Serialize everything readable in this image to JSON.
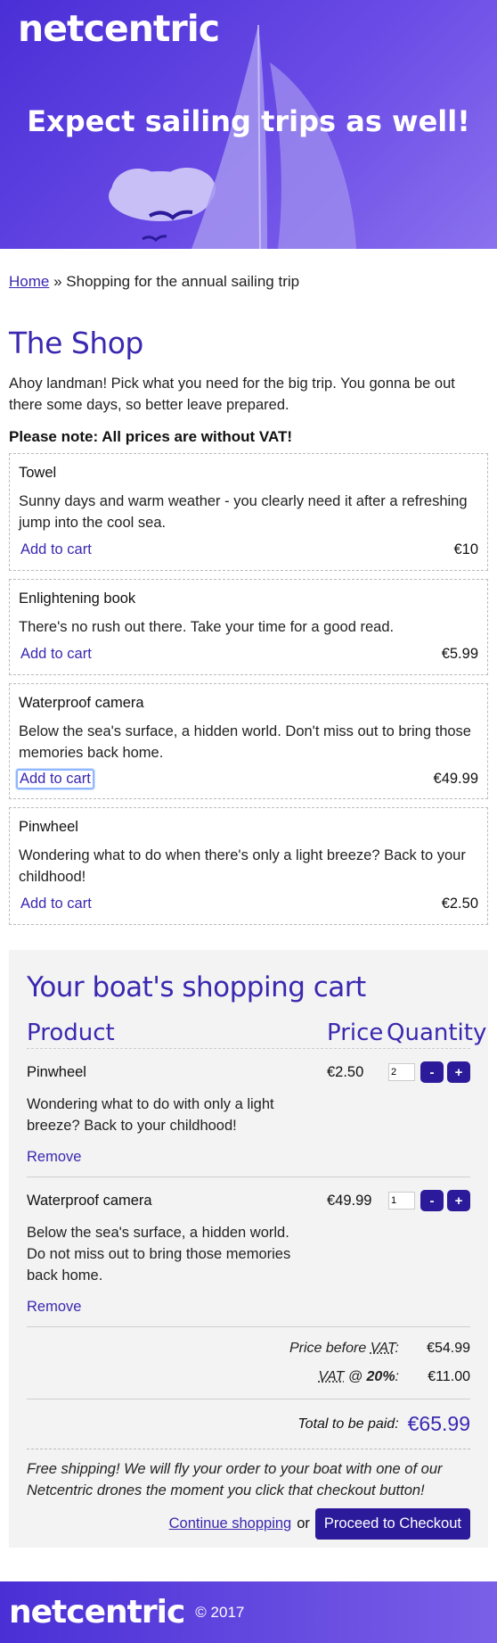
{
  "hero": {
    "logo": "netcentric",
    "headline": "Expect sailing trips as well!"
  },
  "breadcrumb": {
    "home": "Home",
    "separator": "»",
    "current": "Shopping for the annual sailing trip"
  },
  "shop": {
    "title": "The Shop",
    "intro": "Ahoy landman! Pick what you need for the big trip. You gonna be out there some days, so better leave prepared.",
    "note": "Please note: All prices are without VAT!",
    "products": [
      {
        "name": "Towel",
        "desc": "Sunny days and warm weather - you clearly need it after a refreshing jump into the cool sea.",
        "add": "Add to cart",
        "price": "€10"
      },
      {
        "name": "Enlightening book",
        "desc": "There's no rush out there. Take your time for a good read.",
        "add": "Add to cart",
        "price": "€5.99"
      },
      {
        "name": "Waterproof camera",
        "desc": "Below the sea's surface, a hidden world. Don't miss out to bring those memories back home.",
        "add": "Add to cart",
        "price": "€49.99"
      },
      {
        "name": "Pinwheel",
        "desc": "Wondering what to do when there's only a light breeze? Back to your childhood!",
        "add": "Add to cart",
        "price": "€2.50"
      }
    ]
  },
  "cart": {
    "title": "Your boat's shopping cart",
    "headers": {
      "product": "Product",
      "price": "Price",
      "quantity": "Quantity"
    },
    "items": [
      {
        "name": "Pinwheel",
        "price": "€2.50",
        "qty": "2",
        "minus": "-",
        "plus": "+",
        "desc": "Wondering what to do with only a light breeze? Back to your childhood!",
        "remove": "Remove"
      },
      {
        "name": "Waterproof camera",
        "price": "€49.99",
        "qty": "1",
        "minus": "-",
        "plus": "+",
        "desc": "Below the sea's surface, a hidden world. Do not miss out to bring those memories back home.",
        "remove": "Remove"
      }
    ],
    "price_before_vat_label_prefix": "Price before ",
    "price_before_vat_abbr": "VAT",
    "price_before_vat_label_suffix": ":",
    "price_before_vat": "€54.99",
    "vat_abbr": "VAT",
    "vat_at": " @ ",
    "vat_rate": "20%",
    "vat_suffix": ":",
    "vat_value": "€11.00",
    "total_label": "Total to be paid:",
    "total_value": "€65.99",
    "shipping_note": "Free shipping! We will fly your order to your boat with one of our Netcentric drones the moment you click that checkout button!",
    "continue": "Continue shopping",
    "or": "or",
    "checkout": "Proceed to Checkout"
  },
  "footer": {
    "logo": "netcentric",
    "copyright": "© 2017"
  },
  "colors": {
    "brand": "#4a2fd6",
    "accent_text": "#3a28b0",
    "button": "#2b1a9a"
  }
}
